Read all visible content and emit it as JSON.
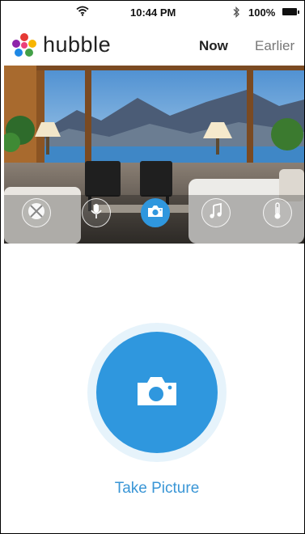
{
  "status_bar": {
    "time": "10:44 PM",
    "battery": "100%",
    "icons": [
      "wifi-icon",
      "bluetooth-icon",
      "battery-icon"
    ]
  },
  "header": {
    "brand": "hubble",
    "tabs": [
      {
        "label": "Now",
        "active": true
      },
      {
        "label": "Earlier",
        "active": false
      }
    ]
  },
  "feed_controls": [
    {
      "name": "pan-tilt-icon",
      "active": false
    },
    {
      "name": "microphone-icon",
      "active": false
    },
    {
      "name": "camera-icon",
      "active": true
    },
    {
      "name": "music-icon",
      "active": false
    },
    {
      "name": "thermometer-icon",
      "active": false
    }
  ],
  "main": {
    "action_label": "Take Picture",
    "action_icon": "camera-icon"
  },
  "colors": {
    "accent": "#2f97de",
    "accent_light": "#e6f3fb",
    "label": "#3a96d6"
  }
}
